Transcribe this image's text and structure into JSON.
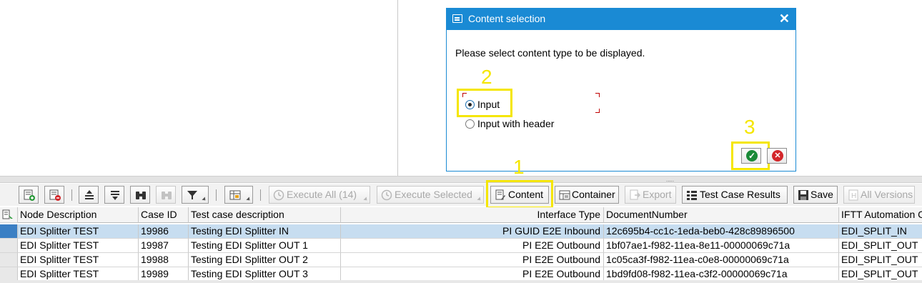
{
  "dialog": {
    "title": "Content selection",
    "close_glyph": "✕",
    "message": "Please select content type to be displayed.",
    "options": [
      {
        "label": "Input",
        "selected": true
      },
      {
        "label": "Input with header",
        "selected": false
      }
    ],
    "ok_icon": "check-circle-icon",
    "cancel_icon": "cancel-circle-icon"
  },
  "annotations": {
    "colour": "#f5e600",
    "step1": "1",
    "step2": "2",
    "step3": "3"
  },
  "splitter": {
    "grip": "....."
  },
  "toolbar": {
    "execute_all": "Execute All (14)",
    "execute_selected": "Execute Selected",
    "content": "Content",
    "container": "Container",
    "export": "Export",
    "test_case_results": "Test Case Results",
    "save": "Save",
    "all_versions": "All Versions"
  },
  "table": {
    "headers": {
      "node_description": "Node Description",
      "case_id": "Case ID",
      "test_case_description": "Test case description",
      "interface_type": "Interface Type",
      "document_number": "DocumentNumber",
      "iftt_automation": "IFTT Automation C"
    },
    "rows": [
      {
        "node": "EDI Splitter TEST",
        "case_id": "19986",
        "desc": "Testing EDI Splitter IN",
        "itype": "PI GUID E2E Inbound",
        "docnum": "12c695b4-cc1c-1eda-beb0-428c89896500",
        "iftt": "EDI_SPLIT_IN"
      },
      {
        "node": "EDI Splitter TEST",
        "case_id": "19987",
        "desc": "Testing EDI Splitter OUT 1",
        "itype": "PI E2E Outbound",
        "docnum": "1bf07ae1-f982-11ea-8e11-00000069c71a",
        "iftt": "EDI_SPLIT_OUT"
      },
      {
        "node": "EDI Splitter TEST",
        "case_id": "19988",
        "desc": "Testing EDI Splitter OUT 2",
        "itype": "PI E2E Outbound",
        "docnum": "1c05ca3f-f982-11ea-c0e8-00000069c71a",
        "iftt": "EDI_SPLIT_OUT"
      },
      {
        "node": "EDI Splitter TEST",
        "case_id": "19989",
        "desc": "Testing EDI Splitter OUT 3",
        "itype": "PI E2E Outbound",
        "docnum": "1bd9fd08-f982-11ea-c3f2-00000069c71a",
        "iftt": "EDI_SPLIT_OUT"
      }
    ]
  }
}
